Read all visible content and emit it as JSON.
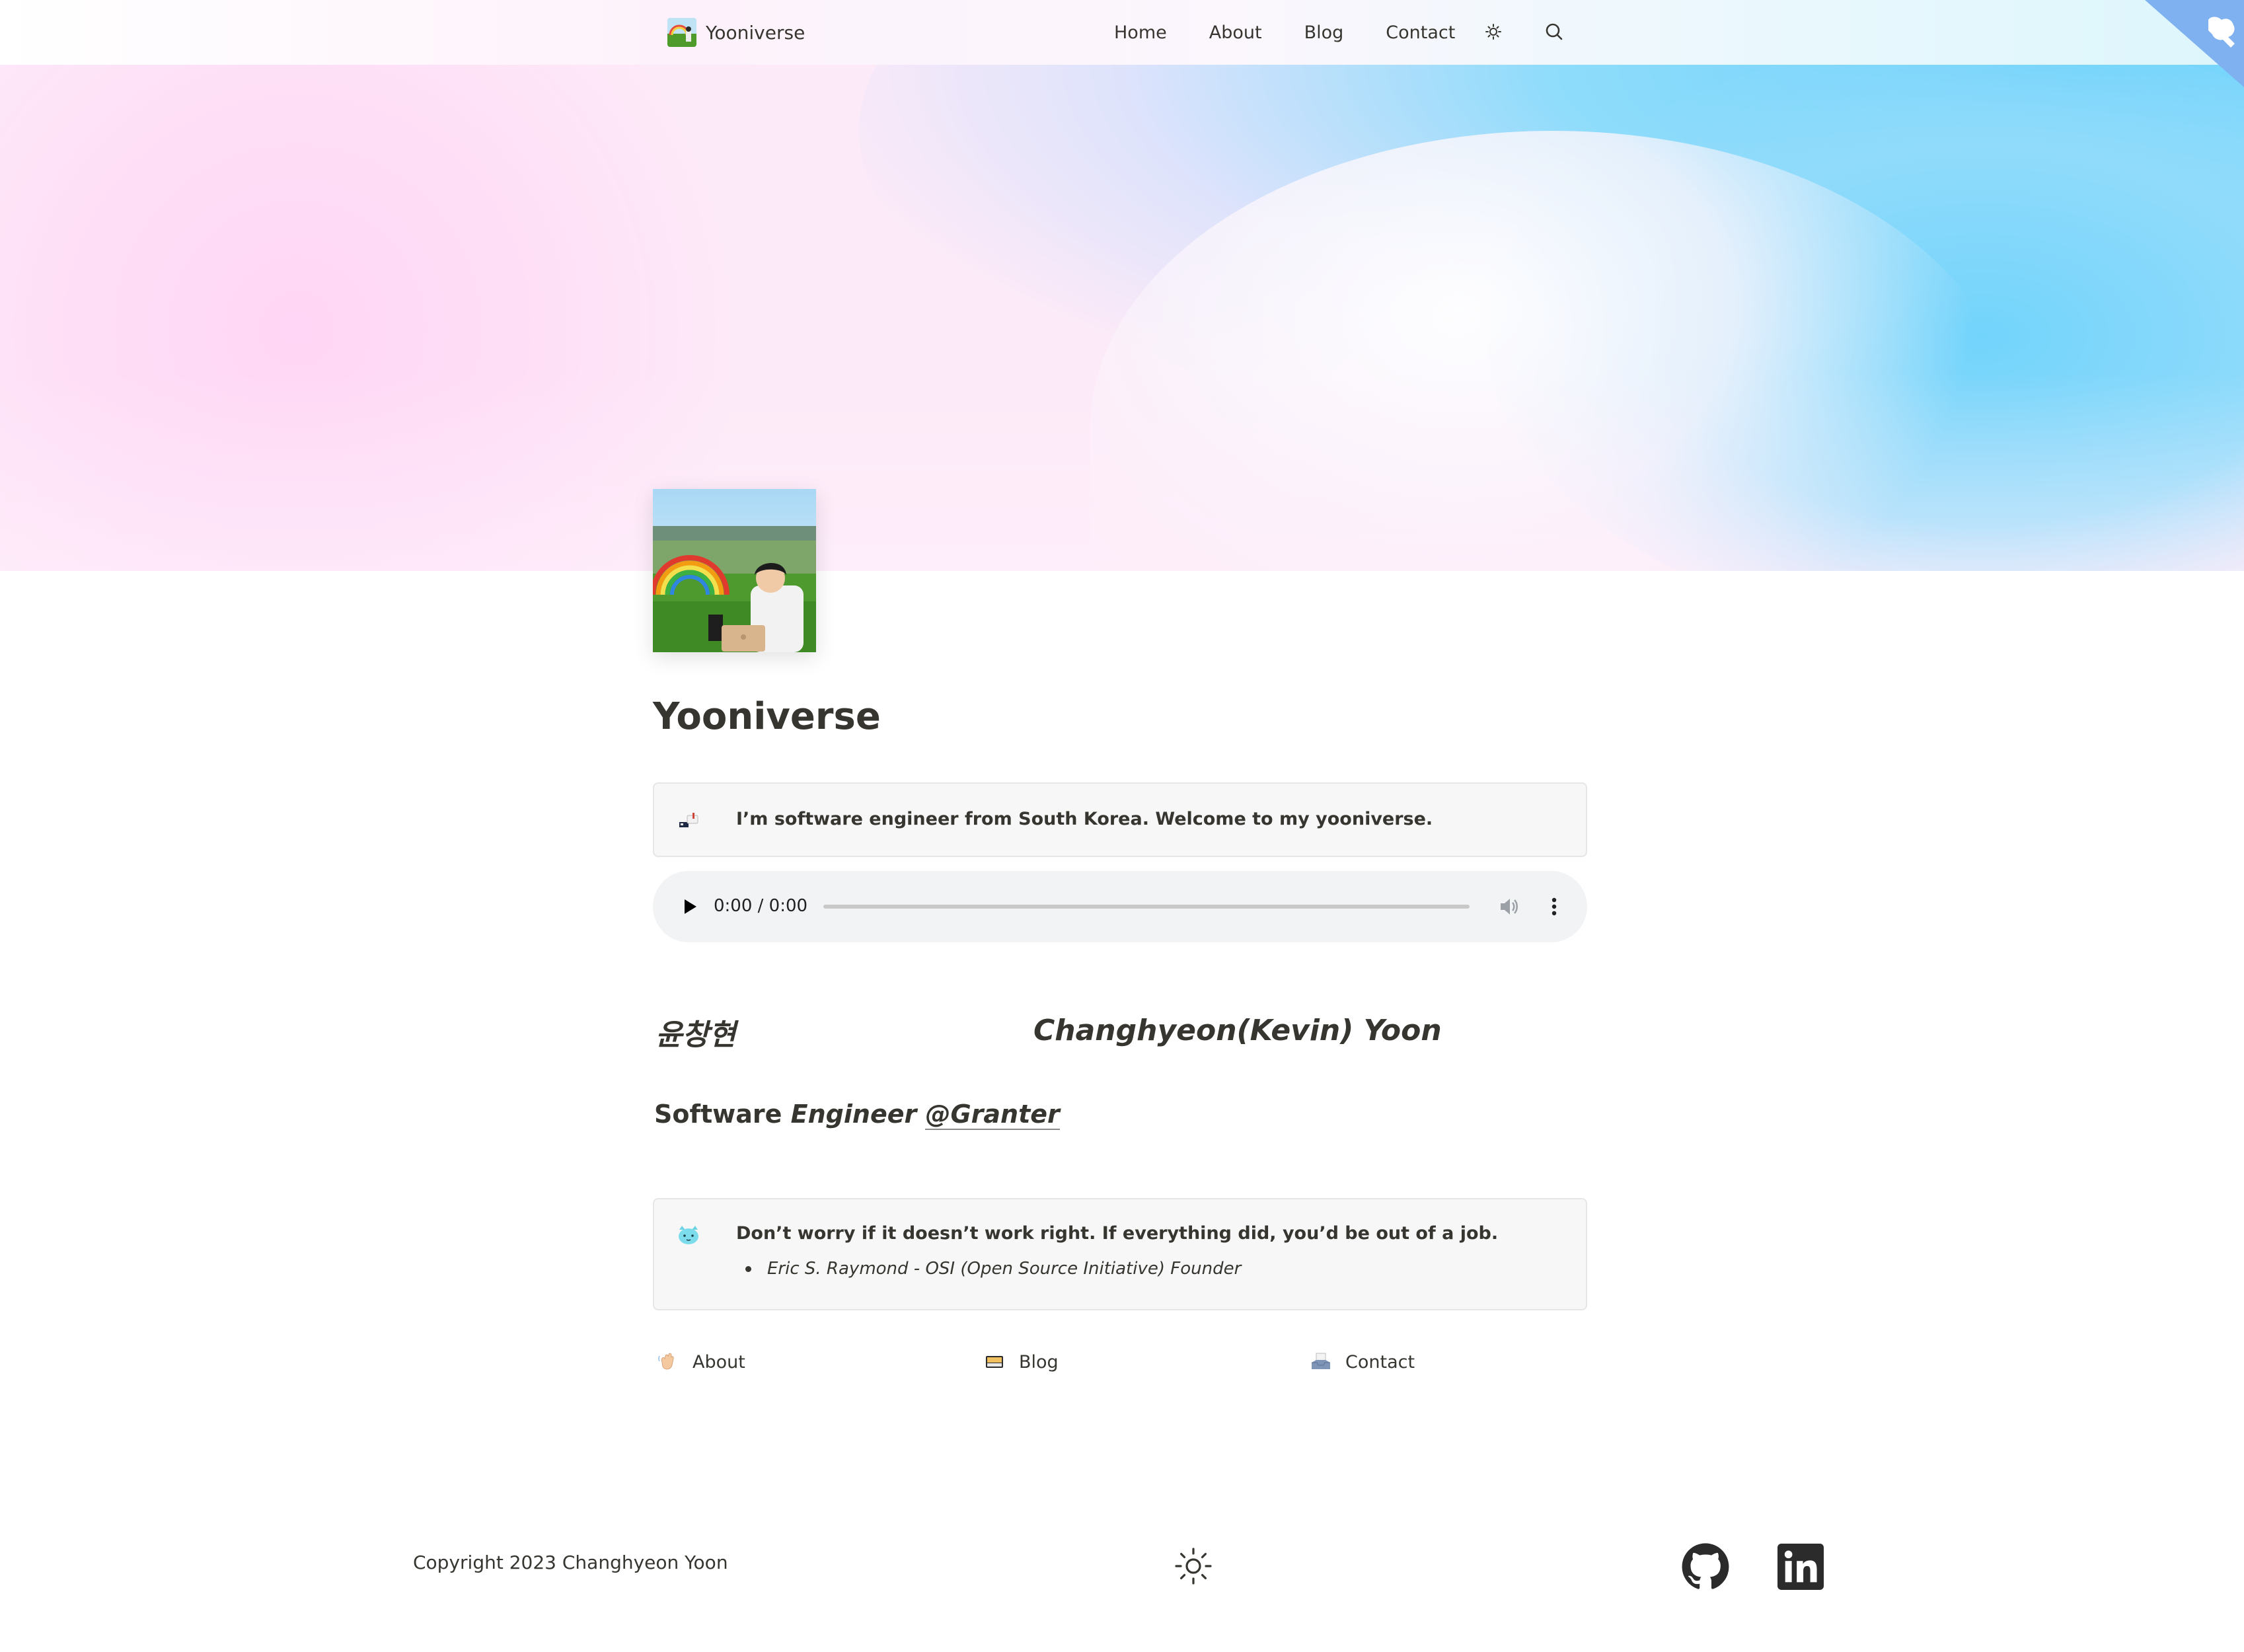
{
  "header": {
    "brand": "Yooniverse",
    "nav": [
      "Home",
      "About",
      "Blog",
      "Contact"
    ],
    "theme_icon": "sun-icon",
    "search_icon": "search-icon"
  },
  "page": {
    "title": "Yooniverse",
    "callout_intro": "I’m software engineer from South Korea. Welcome to my yooniverse.",
    "audio": {
      "time": "0:00 / 0:00"
    },
    "name_korean": "윤창현",
    "name_english": "Changhyeon(Kevin) Yoon",
    "role_plain": "Software ",
    "role_italic": "Engineer ",
    "role_link": "@Granter",
    "quote": "Don’t worry if it doesn’t work right. If everything did, you’d be out of a job.",
    "quote_author": "Eric S. Raymond - OSI (Open Source Initiative) Founder"
  },
  "links": [
    {
      "label": "About",
      "icon": "waving-hand-icon"
    },
    {
      "label": "Blog",
      "icon": "notebook-icon"
    },
    {
      "label": "Contact",
      "icon": "inbox-tray-icon"
    }
  ],
  "footer": {
    "copyright": "Copyright 2023 Changhyeon Yoon",
    "icons": [
      "sun-icon",
      "github-icon",
      "linkedin-icon"
    ]
  },
  "colors": {
    "text": "#37352f",
    "callout_bg": "#f7f7f7",
    "audio_bg": "#f1f3f4",
    "cover_pink": "#ffd6f5",
    "cover_blue": "#6ed2fb"
  }
}
